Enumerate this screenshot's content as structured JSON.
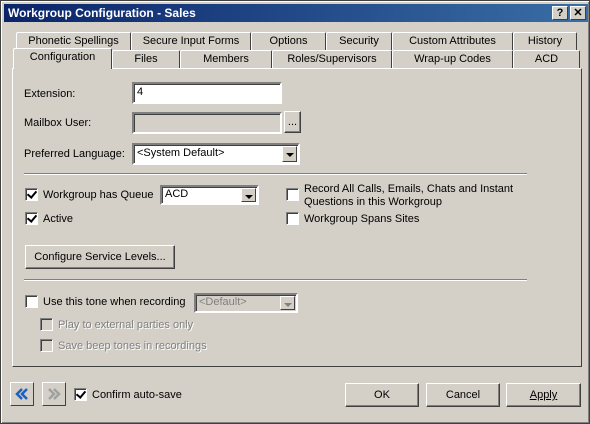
{
  "window": {
    "title": "Workgroup Configuration - Sales",
    "help_glyph": "?",
    "close_glyph": "✕"
  },
  "tabs_back": [
    "Phonetic Spellings",
    "Secure Input Forms",
    "Options",
    "Security",
    "Custom Attributes",
    "History"
  ],
  "tabs_front": [
    "Configuration",
    "Files",
    "Members",
    "Roles/Supervisors",
    "Wrap-up Codes",
    "ACD"
  ],
  "form": {
    "extension_label": "Extension:",
    "extension_value": "4",
    "mailbox_label": "Mailbox User:",
    "mailbox_value": "",
    "browse_label": "...",
    "language_label": "Preferred Language:",
    "language_value": "<System Default>",
    "has_queue_label": "Workgroup has Queue",
    "queue_type_value": "ACD",
    "active_label": "Active",
    "record_all_label_1": "Record All Calls, Emails, Chats and Instant",
    "record_all_label_2": "Questions in this Workgroup",
    "spans_sites_label": "Workgroup Spans Sites",
    "service_levels_button": "Configure Service Levels...",
    "use_tone_label": "Use this tone when recording",
    "tone_value": "<Default>",
    "play_external_label": "Play to external parties only",
    "save_beep_label": "Save beep tones in recordings"
  },
  "footer": {
    "confirm_autosave_label": "Confirm auto-save",
    "ok_label": "OK",
    "cancel_label": "Cancel",
    "apply_label": "Apply"
  },
  "icons": {
    "back": "double-chevron-left-icon",
    "forward": "double-chevron-right-icon"
  },
  "colors": {
    "title_bar": "#0a246a",
    "face": "#d4d0c8",
    "nav_accent": "#1f5fbf"
  }
}
